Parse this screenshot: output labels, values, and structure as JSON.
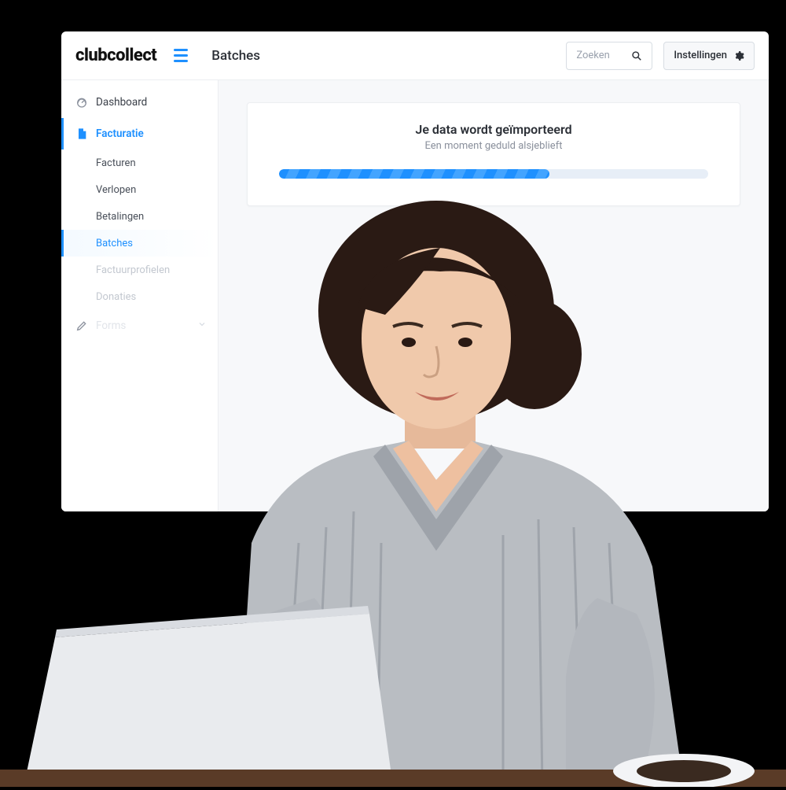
{
  "brand": "clubcollect",
  "header": {
    "page_title": "Batches",
    "search_placeholder": "Zoeken",
    "settings_label": "Instellingen"
  },
  "sidebar": {
    "dashboard": "Dashboard",
    "facturatie": "Facturatie",
    "sub": {
      "facturen": "Facturen",
      "verlopen": "Verlopen",
      "betalingen": "Betalingen",
      "batches": "Batches",
      "factuurprofielen": "Factuurprofielen",
      "donaties": "Donaties"
    },
    "forms": "Forms"
  },
  "import_card": {
    "title": "Je data wordt geïmporteerd",
    "subtitle": "Een moment geduld alsjeblieft",
    "progress_percent": 63
  }
}
